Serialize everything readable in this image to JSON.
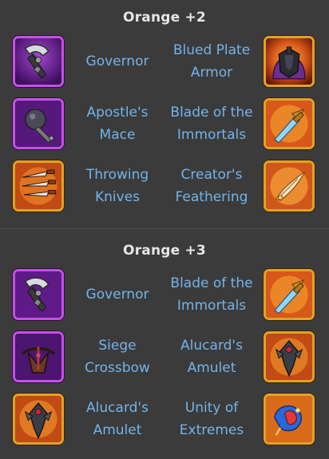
{
  "sections": [
    {
      "title": "Orange +2",
      "rows": [
        {
          "left": {
            "name": "Governor",
            "icon": "governor-axe-icon",
            "frame": "purple"
          },
          "right": {
            "name": "Blued Plate Armor",
            "icon": "blued-plate-armor-icon",
            "frame": "gold"
          }
        },
        {
          "left": {
            "name": "Apostle's Mace",
            "icon": "apostles-mace-icon",
            "frame": "purple"
          },
          "right": {
            "name": "Blade of the Immortals",
            "icon": "blade-of-the-immortals-icon",
            "frame": "gold"
          }
        },
        {
          "left": {
            "name": "Throwing Knives",
            "icon": "throwing-knives-icon",
            "frame": "gold"
          },
          "right": {
            "name": "Creator's Feathering",
            "icon": "creators-feathering-icon",
            "frame": "gold"
          }
        }
      ]
    },
    {
      "title": "Orange +3",
      "rows": [
        {
          "left": {
            "name": "Governor",
            "icon": "governor-axe-icon",
            "frame": "purple"
          },
          "right": {
            "name": "Blade of the Immortals",
            "icon": "blade-of-the-immortals-icon",
            "frame": "gold"
          }
        },
        {
          "left": {
            "name": "Siege Crossbow",
            "icon": "siege-crossbow-icon",
            "frame": "purple"
          },
          "right": {
            "name": "Alucard's Amulet",
            "icon": "alucards-amulet-icon",
            "frame": "gold"
          }
        },
        {
          "left": {
            "name": "Alucard's Amulet",
            "icon": "alucards-amulet-icon",
            "frame": "gold"
          },
          "right": {
            "name": "Unity of Extremes",
            "icon": "unity-of-extremes-icon",
            "frame": "gold"
          }
        }
      ]
    }
  ],
  "colors": {
    "background": "#3b3b3b",
    "title": "#e6e6e6",
    "item_label": "#74b3ea",
    "frame_purple": "#c451e6",
    "frame_gold": "#e0a22a"
  }
}
